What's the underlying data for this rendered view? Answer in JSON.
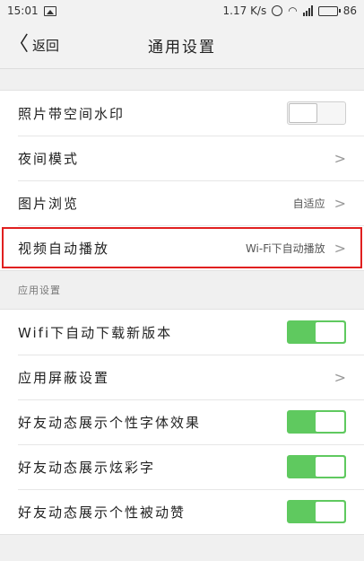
{
  "status_bar": {
    "time": "15:01",
    "speed": "1.17 K/s",
    "battery": "86"
  },
  "nav": {
    "back_label": "返回",
    "title": "通用设置"
  },
  "group1": {
    "items": [
      {
        "label": "照片带空间水印",
        "type": "toggle",
        "state": "off"
      },
      {
        "label": "夜间模式",
        "type": "link"
      },
      {
        "label": "图片浏览",
        "type": "link",
        "value": "自适应"
      },
      {
        "label": "视频自动播放",
        "type": "link",
        "value": "Wi-Fi下自动播放"
      }
    ]
  },
  "section_header": "应用设置",
  "group2": {
    "items": [
      {
        "label": "Wifi下自动下载新版本",
        "type": "toggle",
        "state": "on"
      },
      {
        "label": "应用屏蔽设置",
        "type": "link"
      },
      {
        "label": "好友动态展示个性字体效果",
        "type": "toggle",
        "state": "on"
      },
      {
        "label": "好友动态展示炫彩字",
        "type": "toggle",
        "state": "on"
      },
      {
        "label": "好友动态展示个性被动赞",
        "type": "toggle",
        "state": "on"
      }
    ]
  },
  "colors": {
    "toggle_on": "#5fc95f",
    "highlight": "#e02020"
  }
}
